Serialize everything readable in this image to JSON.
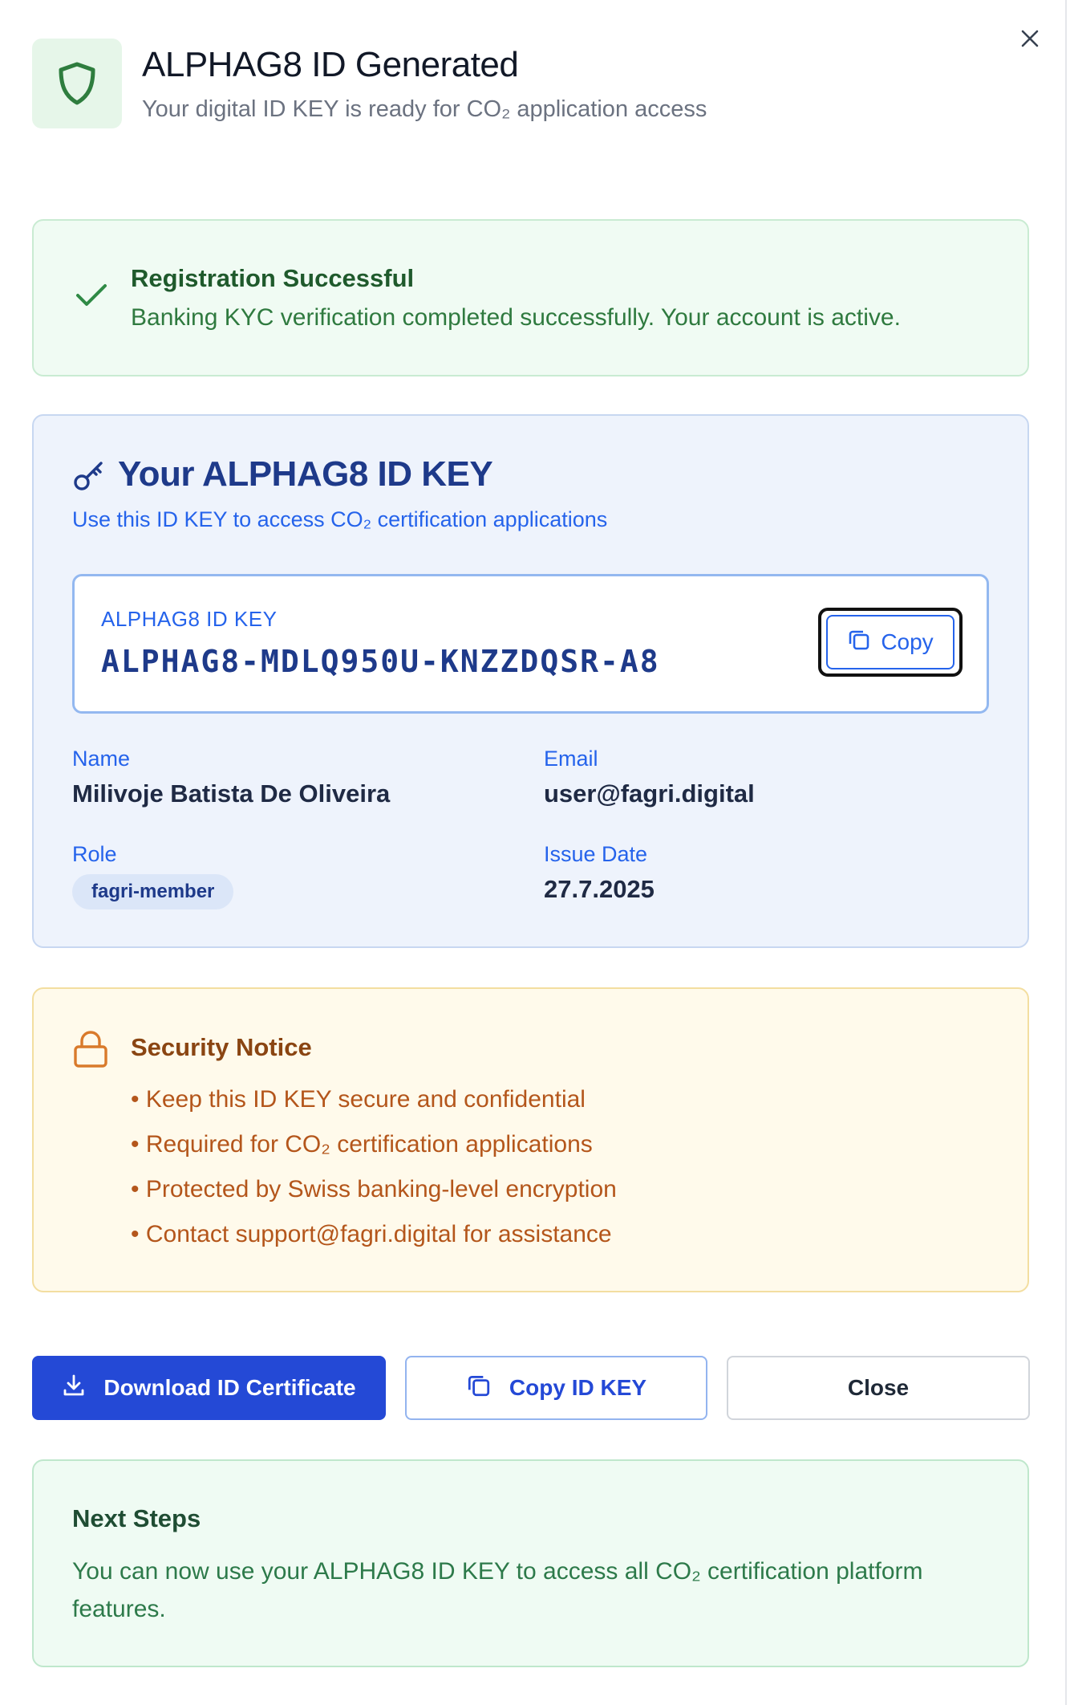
{
  "colors": {
    "success_bg": "#f0fbf3",
    "key_bg": "#eef3fc",
    "notice_bg": "#fffaeb",
    "primary": "#2449d6"
  },
  "header": {
    "icon": "shield-icon",
    "title": "ALPHAG8 ID Generated",
    "subtitle": "Your digital ID KEY is ready for CO₂ application access",
    "close_icon": "close-icon"
  },
  "success": {
    "icon": "check-icon",
    "title": "Registration Successful",
    "message": "Banking KYC verification completed successfully. Your account is active."
  },
  "key_card": {
    "icon": "key-icon",
    "title": "Your ALPHAG8 ID KEY",
    "subtitle": "Use this ID KEY to access CO₂ certification applications",
    "key_label": "ALPHAG8 ID KEY",
    "key_value": "ALPHAG8-MDLQ950U-KNZZDQSR-A8",
    "copy_label": "Copy",
    "fields": {
      "name_label": "Name",
      "name_value": "Milivoje Batista De Oliveira",
      "email_label": "Email",
      "email_value": "user@fagri.digital",
      "role_label": "Role",
      "role_value": "fagri-member",
      "issue_label": "Issue Date",
      "issue_value": "27.7.2025"
    }
  },
  "notice": {
    "icon": "lock-icon",
    "title": "Security Notice",
    "items": [
      "Keep this ID KEY secure and confidential",
      "Required for CO₂ certification applications",
      "Protected by Swiss banking-level encryption",
      "Contact support@fagri.digital for assistance"
    ]
  },
  "actions": {
    "download_label": "Download ID Certificate",
    "copy_key_label": "Copy ID KEY",
    "close_label": "Close"
  },
  "next_steps": {
    "title": "Next Steps",
    "message": "You can now use your ALPHAG8 ID KEY to access all CO₂ certification platform features."
  }
}
